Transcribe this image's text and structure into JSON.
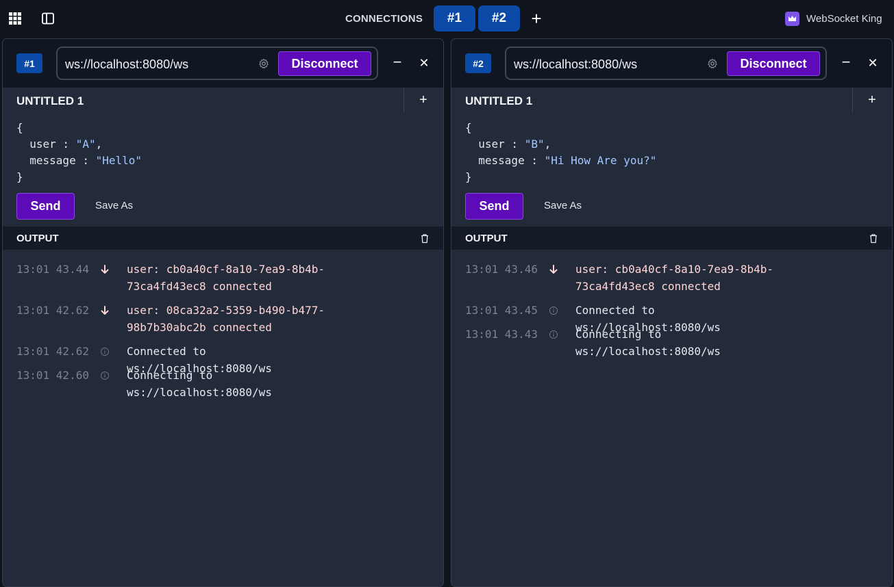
{
  "app": {
    "brand_name": "WebSocket King",
    "connections_label": "CONNECTIONS",
    "tabs": [
      {
        "label": "#1"
      },
      {
        "label": "#2"
      }
    ],
    "add_connection_label": "+"
  },
  "colors": {
    "background": "#0f141d",
    "panel": "#232a39",
    "tab_blue": "#0b4aa7",
    "button_purple": "#5d0bb8",
    "brand_purple": "#7c55e8"
  },
  "panels": [
    {
      "badge": "#1",
      "url": "ws://localhost:8080/ws",
      "disconnect_label": "Disconnect",
      "minimize_label": "−",
      "close_label": "✕",
      "doc_title": "UNTITLED 1",
      "add_doc_label": "+",
      "editor": {
        "open": "{",
        "line1_key": "  user : ",
        "line1_value": "\"A\"",
        "line1_tail": ",",
        "line2_key": "  message : ",
        "line2_value": "\"Hello\"",
        "close": "}"
      },
      "send_label": "Send",
      "save_as_label": "Save As",
      "output_title": "OUTPUT",
      "logs": [
        {
          "time": "13:01 43.44",
          "icon": "arrow-down-icon",
          "text": "user: cb0a40cf-8a10-7ea9-8b4b-73ca4fd43ec8 connected"
        },
        {
          "time": "13:01 42.62",
          "icon": "arrow-down-icon",
          "text": "user: 08ca32a2-5359-b490-b477-98b7b30abc2b connected"
        },
        {
          "time": "13:01 42.62",
          "icon": "info-icon",
          "text": "Connected to ws://localhost:8080/ws"
        },
        {
          "time": "13:01 42.60",
          "icon": "info-icon",
          "text": "Connecting to ws://localhost:8080/ws"
        }
      ]
    },
    {
      "badge": "#2",
      "url": "ws://localhost:8080/ws",
      "disconnect_label": "Disconnect",
      "minimize_label": "−",
      "close_label": "✕",
      "doc_title": "UNTITLED 1",
      "add_doc_label": "+",
      "editor": {
        "open": "{",
        "line1_key": "  user : ",
        "line1_value": "\"B\"",
        "line1_tail": ",",
        "line2_key": "  message : ",
        "line2_value": "\"Hi How Are you?\"",
        "close": "}"
      },
      "send_label": "Send",
      "save_as_label": "Save As",
      "output_title": "OUTPUT",
      "logs": [
        {
          "time": "13:01 43.46",
          "icon": "arrow-down-icon",
          "text": "user: cb0a40cf-8a10-7ea9-8b4b-73ca4fd43ec8 connected"
        },
        {
          "time": "13:01 43.45",
          "icon": "info-icon",
          "text": "Connected to ws://localhost:8080/ws"
        },
        {
          "time": "13:01 43.43",
          "icon": "info-icon",
          "text": "Connecting to ws://localhost:8080/ws"
        }
      ]
    }
  ]
}
